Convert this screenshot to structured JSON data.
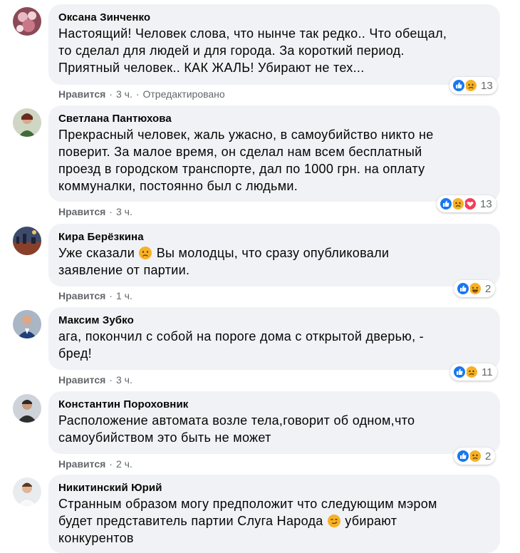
{
  "colors": {
    "bubble_bg": "#f0f2f5",
    "meta_text": "#65676b",
    "like_blue": "#1877f2",
    "sad_yellow": "#f7b125",
    "love_red": "#f33e58"
  },
  "comments": [
    {
      "author": "Оксана Зинченко",
      "lines": [
        "Настоящий! Человек слова, что нынче так редко.. Что обещал,",
        "то сделал для людей и для города. За короткий период.",
        "Приятный человек.. КАК ЖАЛЬ! Убирают не тех..."
      ],
      "like_label": "Нравится",
      "time": "3 ч.",
      "edited": "Отредактировано",
      "reactions": [
        "like-icon",
        "sad-icon"
      ],
      "reaction_count": "13"
    },
    {
      "author": "Светлана Пантюхова",
      "lines": [
        "Прекрасный человек, жаль ужасно, в самоубийство никто не",
        "поверит. За малое время, он сделал нам всем бесплатный",
        "проезд в городском транспорте, дал по 1000 грн. на оплату",
        "коммуналки, постоянно был с людьми."
      ],
      "like_label": "Нравится",
      "time": "3 ч.",
      "reactions": [
        "like-icon",
        "sad-icon",
        "love-icon"
      ],
      "reaction_count": "13"
    },
    {
      "author": "Кира Берёзкина",
      "lines": [
        "Уже сказали [frown] Вы молодцы, что сразу опубликовали",
        "заявление от партии."
      ],
      "like_label": "Нравится",
      "time": "1 ч.",
      "reactions": [
        "like-icon",
        "haha-icon"
      ],
      "reaction_count": "2"
    },
    {
      "author": "Максим Зубко",
      "lines": [
        "ага, покончил с собой на пороге дома с открытой дверью, -",
        "бред!"
      ],
      "like_label": "Нравится",
      "time": "3 ч.",
      "reactions": [
        "like-icon",
        "sad-icon"
      ],
      "reaction_count": "11"
    },
    {
      "author": "Константин Пороховник",
      "lines": [
        "Расположение автомата возле тела,говорит об одном,что",
        "самоубийством это быть не может"
      ],
      "like_label": "Нравится",
      "time": "2 ч.",
      "reactions": [
        "like-icon",
        "sad-icon"
      ],
      "reaction_count": "2"
    },
    {
      "author": "Никитинский Юрий",
      "lines": [
        "Странным образом могу предположит что следующим мэром",
        "будет представитель партии Слуга Народа [smirk] убирают",
        "конкурентов"
      ]
    }
  ]
}
